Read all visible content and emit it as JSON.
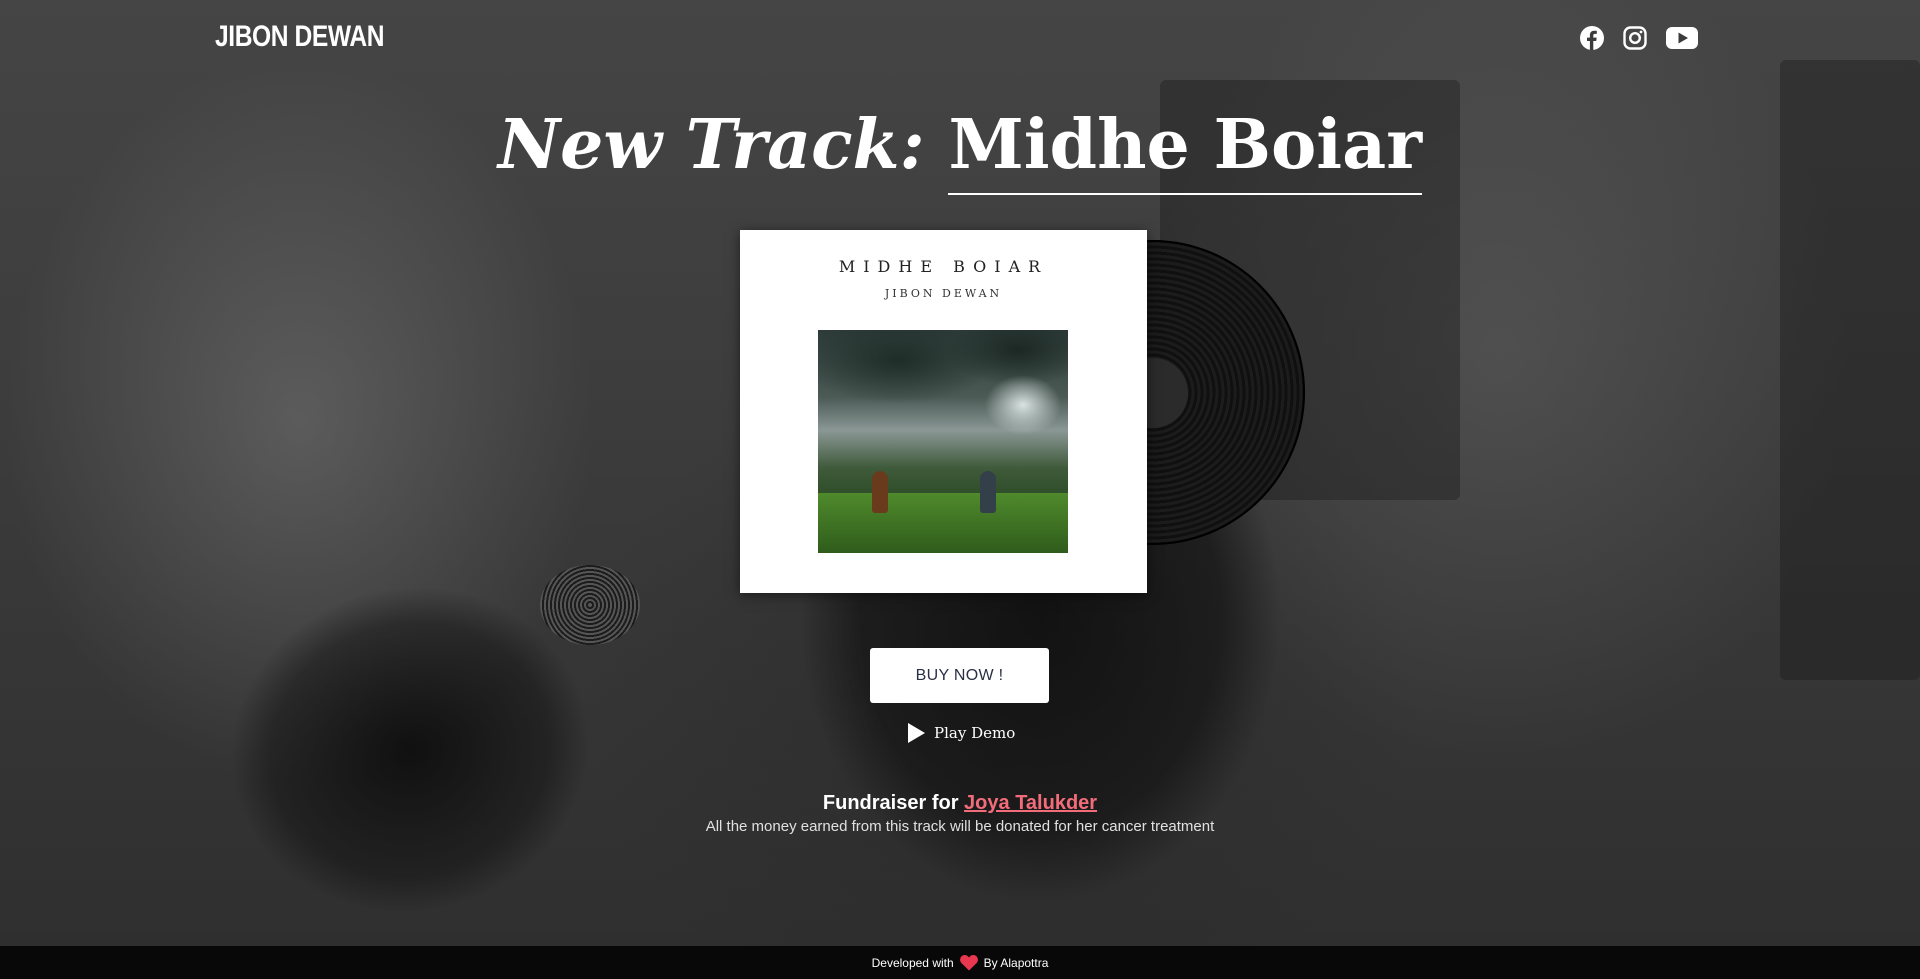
{
  "header": {
    "logo": "JIBON DEWAN",
    "socials": [
      {
        "icon": "facebook-icon"
      },
      {
        "icon": "instagram-icon"
      },
      {
        "icon": "youtube-icon"
      }
    ]
  },
  "hero": {
    "title_lead": "New Track:",
    "title_track": "Midhe Boiar"
  },
  "album": {
    "cover_title": "MIDHE BOIAR",
    "cover_artist": "JIBON DEWAN"
  },
  "actions": {
    "buy_label": "BUY NOW !",
    "demo_label": "Play Demo"
  },
  "fundraiser": {
    "prefix": "Fundraiser for",
    "name": "Joya Talukder",
    "note": "All the money earned from this track will be donated for her cancer treatment"
  },
  "footer": {
    "developed_with": "Developed with",
    "by": "By Alapottra"
  },
  "colors": {
    "link": "#f26c7a",
    "heart": "#e8384f",
    "footer_bg": "#080808",
    "button_text": "#2a2f45"
  }
}
